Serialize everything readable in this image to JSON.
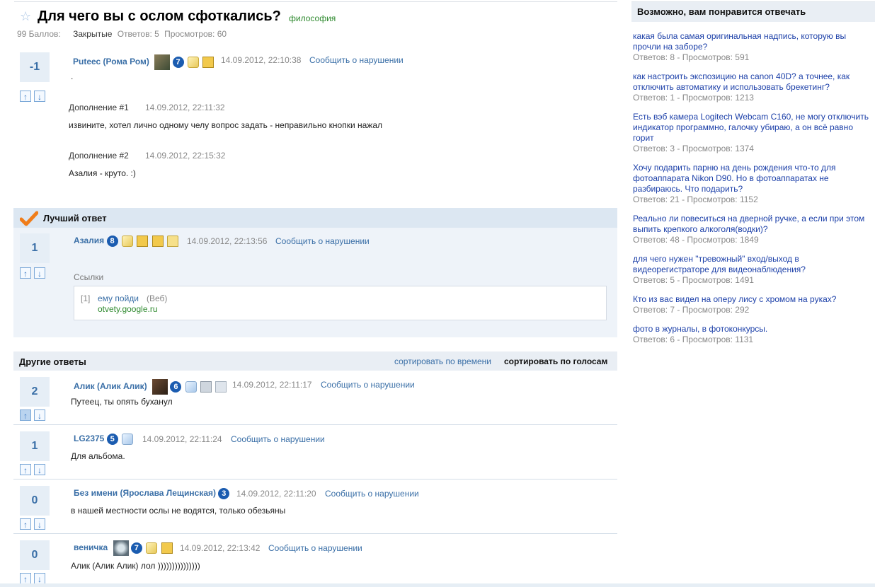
{
  "question": {
    "title": "Для чего вы с ослом сфоткались?",
    "category": "философия",
    "points": "99 Баллов:",
    "status": "Закрытые",
    "answers": "Ответов: 5",
    "views": "Просмотров: 60",
    "author": "Putеес (Рома Ром)",
    "level": "7",
    "time": "14.09.2012, 22:10:38",
    "report": "Сообщить о нарушении",
    "score": "-1",
    "body": ".",
    "addons": [
      {
        "label": "Дополнение #1",
        "time": "14.09.2012, 22:11:32",
        "text": "извините, хотел лично одному челу вопрос задать - неправильно кнопки нажал"
      },
      {
        "label": "Дополнение #2",
        "time": "14.09.2012, 22:15:32",
        "text": "Азалия - круто. :)"
      }
    ]
  },
  "best_answer": {
    "header": "Лучший ответ",
    "author": "Азалия",
    "level": "8",
    "time": "14.09.2012, 22:13:56",
    "report": "Сообщить о нарушении",
    "score": "1",
    "links_label": "Ссылки",
    "link": {
      "num": "[1]",
      "text": "ему пойди",
      "source": "(Веб)",
      "url": "otvety.google.ru"
    }
  },
  "others": {
    "header": "Другие ответы",
    "sort_time": "сортировать по времени",
    "sort_votes": "сортировать по голосам",
    "items": [
      {
        "author": "Алик (Алик Алик)",
        "level": "6",
        "time": "14.09.2012, 22:11:17",
        "report": "Сообщить о нарушении",
        "score": "2",
        "text": "Путеец, ты опять буханул"
      },
      {
        "author": "LG2375",
        "level": "5",
        "time": "14.09.2012, 22:11:24",
        "report": "Сообщить о нарушении",
        "score": "1",
        "text": "Для альбома."
      },
      {
        "author": "Без имени (Ярослава Лещинская)",
        "level": "3",
        "time": "14.09.2012, 22:11:20",
        "report": "Сообщить о нарушении",
        "score": "0",
        "text": "в  нашей местности ослы не водятся, только обезьяны"
      },
      {
        "author": "веничка",
        "level": "7",
        "time": "14.09.2012, 22:13:42",
        "report": "Сообщить о нарушении",
        "score": "0",
        "text": "Алик (Алик Алик) лол )))))))))))))))"
      }
    ]
  },
  "recommended": {
    "title": "Возможно, вам понравится отвечать",
    "items": [
      {
        "lines": [
          "какая была самая оригинальная надпись, которую вы",
          "прочли на заборе?"
        ],
        "meta": "Ответов: 8  -  Просмотров: 591"
      },
      {
        "lines": [
          "как настроить экспозицию на canon 40D? а точнее, как",
          "отключить автоматику и использовать брекетинг?"
        ],
        "meta": "Ответов: 1  -  Просмотров: 1213"
      },
      {
        "lines": [
          "Есть вэб камера Logitech Webcam C160, не могу отключить",
          "индикатор программно, галочку убираю, а он всё равно",
          "горит"
        ],
        "meta": "Ответов: 3  -  Просмотров: 1374"
      },
      {
        "lines": [
          "Хочу подарить парню на день рождения что-то для",
          "фотоаппарата Nikon D90. Но в фотоаппаратах не",
          "разбираюсь. Что подарить?"
        ],
        "meta": "Ответов: 21  -  Просмотров: 1152"
      },
      {
        "lines": [
          "Реально ли повеситься на дверной ручке, а если при этом",
          "выпить крепкого алкоголя(водки)?"
        ],
        "meta": "Ответов: 48  -  Просмотров: 1849"
      },
      {
        "lines": [
          "для чего нужен \"тревожный\" вход/выход в",
          "видеорегистраторе для видеонаблюдения?"
        ],
        "meta": "Ответов: 5  -  Просмотров: 1491"
      },
      {
        "lines": [
          "Кто из вас видел на оперу лису с хромом на руках?"
        ],
        "meta": "Ответов: 7  -  Просмотров: 292"
      },
      {
        "lines": [
          "фото в журналы, в фотоконкурсы."
        ],
        "meta": "Ответов: 6  -  Просмотров: 1131"
      }
    ]
  },
  "colors": {
    "link": "#3a6fa7",
    "category": "#2f8a2f",
    "best_bg": "#eef3f9",
    "best_check": "#f07d1a"
  }
}
